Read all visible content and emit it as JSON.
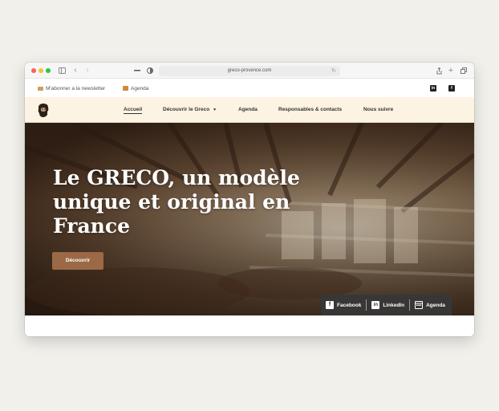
{
  "browser": {
    "url": "greco-provence.com",
    "icons": [
      "sidebar-icon",
      "back-icon",
      "forward-icon",
      "shield-icon",
      "reload-icon",
      "share-icon",
      "new-tab-icon",
      "tabs-icon"
    ]
  },
  "topbar": {
    "newsletter_label": "M'abonner a la newsletter",
    "agenda_label": "Agenda",
    "social_icons": [
      "linkedin-icon",
      "facebook-icon"
    ]
  },
  "nav": {
    "items": [
      {
        "label": "Accueil",
        "active": true
      },
      {
        "label": "Découvrir le Greco",
        "has_dropdown": true
      },
      {
        "label": "Agenda"
      },
      {
        "label": "Responsables & contacts"
      },
      {
        "label": "Nous suivre"
      }
    ]
  },
  "hero": {
    "title": "Le GRECO, un modèle unique et original en France",
    "button_label": "Découvrir"
  },
  "social_bar": {
    "facebook_label": "Facebook",
    "linkedin_label": "LinkedIn",
    "agenda_label": "Agenda"
  },
  "colors": {
    "accent": "#9b6945",
    "nav_bg": "#fdf3e2",
    "page_bg": "#f1f0eb"
  }
}
